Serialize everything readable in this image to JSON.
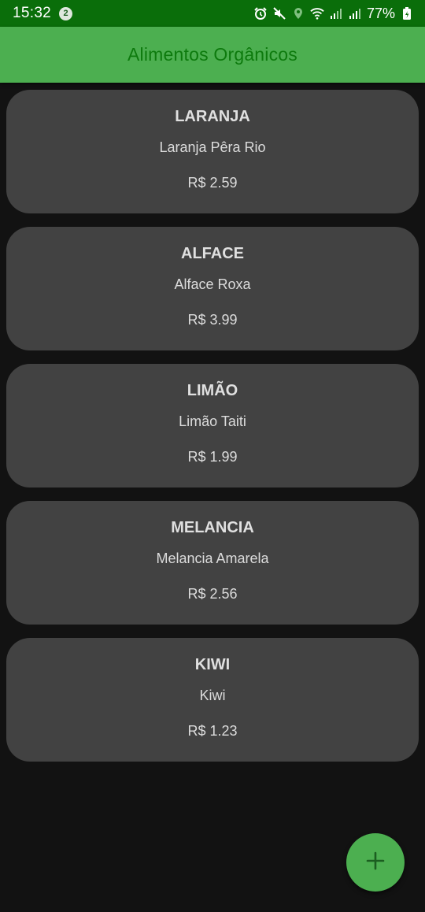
{
  "status_bar": {
    "time": "15:32",
    "notification_count": "2",
    "battery": "77%",
    "icons": [
      "alarm-icon",
      "mute-icon",
      "location-icon",
      "wifi-icon",
      "signal-icon",
      "signal-icon",
      "battery-icon"
    ]
  },
  "app_bar": {
    "title": "Alimentos Orgânicos"
  },
  "products": [
    {
      "name": "LARANJA",
      "description": "Laranja Pêra Rio",
      "price": "R$ 2.59"
    },
    {
      "name": "ALFACE",
      "description": "Alface Roxa",
      "price": "R$ 3.99"
    },
    {
      "name": "LIMÃO",
      "description": "Limão Taiti",
      "price": "R$ 1.99"
    },
    {
      "name": "MELANCIA",
      "description": "Melancia Amarela",
      "price": "R$ 2.56"
    },
    {
      "name": "KIWI",
      "description": "Kiwi",
      "price": "R$ 1.23"
    }
  ],
  "fab": {
    "icon": "plus-icon"
  },
  "colors": {
    "status_bar": "#0a6e0a",
    "app_bar": "#4caf50",
    "title_text": "#0d7a0d",
    "background": "#121212",
    "card": "#424242",
    "fab": "#4caf50",
    "fab_icon": "#1b5e20"
  }
}
